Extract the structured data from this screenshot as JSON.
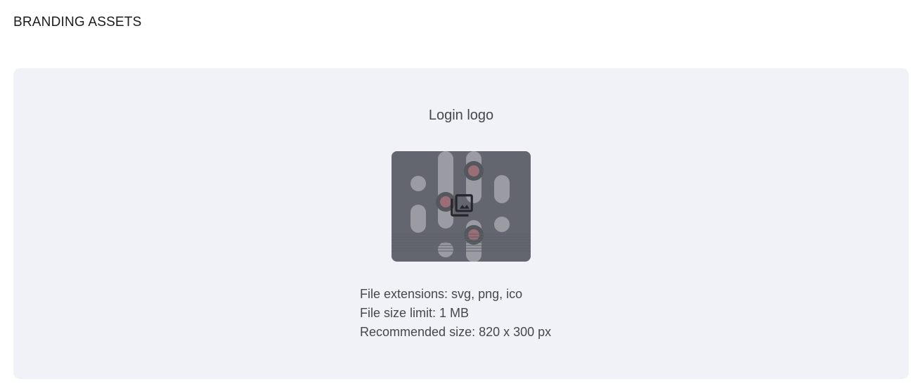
{
  "section": {
    "title": "BRANDING ASSETS"
  },
  "login_logo": {
    "title": "Login logo",
    "upload_icon": "add-photo-library-icon",
    "file_extensions": "File extensions: svg, png, ico",
    "file_size_limit": "File size limit: 1 MB",
    "recommended_size": "Recommended size: 820 x 300 px"
  },
  "colors": {
    "panel_background": "#f1f2f7",
    "preview_background": "#6a6c74",
    "text_primary": "#45464f"
  }
}
